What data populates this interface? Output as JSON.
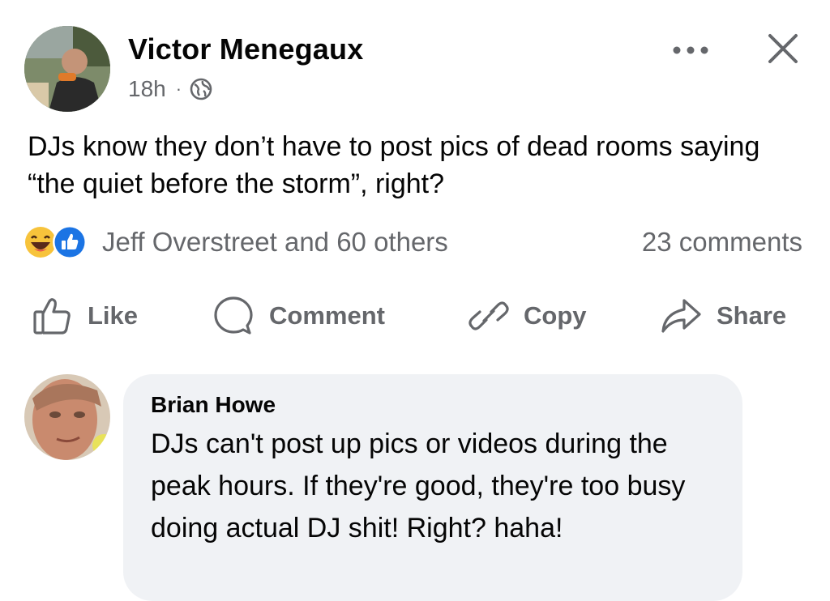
{
  "post": {
    "author_name": "Victor Menegaux",
    "timestamp": "18h",
    "separator": "·",
    "privacy_icon": "globe-icon",
    "text": "DJs know they don’t have to post pics of dead rooms saying “the quiet before the storm”, right?"
  },
  "reactions": {
    "icons": [
      "laugh-reaction-icon",
      "like-reaction-icon"
    ],
    "summary": "Jeff Overstreet and 60 others",
    "comments": "23 comments"
  },
  "actions": {
    "like": "Like",
    "comment": "Comment",
    "copy": "Copy",
    "share": "Share"
  },
  "comment": {
    "author_name": "Brian Howe",
    "text": "DJs can't post up pics or videos during the peak hours. If they're good, they're too busy doing actual DJ shit! Right? haha!"
  },
  "colors": {
    "text_primary": "#050505",
    "text_secondary": "#65676b",
    "bubble_bg": "#f0f2f5",
    "like_blue": "#1b74e4",
    "laugh_yellow": "#f7c33b"
  }
}
